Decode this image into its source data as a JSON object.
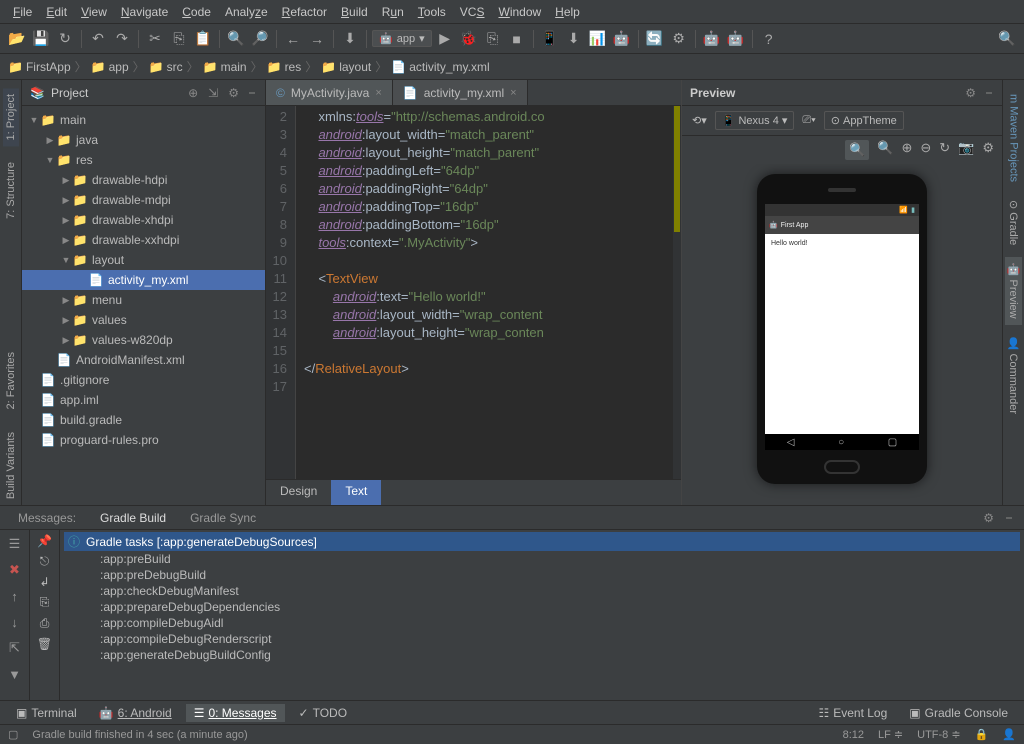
{
  "menu": {
    "items": [
      "File",
      "Edit",
      "View",
      "Navigate",
      "Code",
      "Analyze",
      "Refactor",
      "Build",
      "Run",
      "Tools",
      "VCS",
      "Window",
      "Help"
    ]
  },
  "toolbar": {
    "appSelector": "app"
  },
  "breadcrumb": [
    "FirstApp",
    "app",
    "src",
    "main",
    "res",
    "layout",
    "activity_my.xml"
  ],
  "leftGutter": {
    "project": "1: Project",
    "structure": "7: Structure",
    "favorites": "2: Favorites",
    "build": "Build Variants"
  },
  "rightGutter": {
    "maven": "Maven Projects",
    "gradle": "Gradle",
    "preview": "Preview",
    "commander": "Commander"
  },
  "projectPanel": {
    "title": "Project",
    "tree": [
      {
        "indent": 0,
        "arrow": "▼",
        "icon": "📁",
        "label": "main",
        "type": "folder"
      },
      {
        "indent": 1,
        "arrow": "▶",
        "icon": "📁",
        "label": "java",
        "type": "folder"
      },
      {
        "indent": 1,
        "arrow": "▼",
        "icon": "📁",
        "label": "res",
        "type": "folder"
      },
      {
        "indent": 2,
        "arrow": "▶",
        "icon": "📁",
        "label": "drawable-hdpi",
        "type": "folder"
      },
      {
        "indent": 2,
        "arrow": "▶",
        "icon": "📁",
        "label": "drawable-mdpi",
        "type": "folder"
      },
      {
        "indent": 2,
        "arrow": "▶",
        "icon": "📁",
        "label": "drawable-xhdpi",
        "type": "folder"
      },
      {
        "indent": 2,
        "arrow": "▶",
        "icon": "📁",
        "label": "drawable-xxhdpi",
        "type": "folder"
      },
      {
        "indent": 2,
        "arrow": "▼",
        "icon": "📁",
        "label": "layout",
        "type": "folder"
      },
      {
        "indent": 3,
        "arrow": "",
        "icon": "📄",
        "label": "activity_my.xml",
        "type": "xml",
        "selected": true
      },
      {
        "indent": 2,
        "arrow": "▶",
        "icon": "📁",
        "label": "menu",
        "type": "folder"
      },
      {
        "indent": 2,
        "arrow": "▶",
        "icon": "📁",
        "label": "values",
        "type": "folder"
      },
      {
        "indent": 2,
        "arrow": "▶",
        "icon": "📁",
        "label": "values-w820dp",
        "type": "folder"
      },
      {
        "indent": 1,
        "arrow": "",
        "icon": "📄",
        "label": "AndroidManifest.xml",
        "type": "xml"
      },
      {
        "indent": 0,
        "arrow": "",
        "icon": "📄",
        "label": ".gitignore",
        "type": "file"
      },
      {
        "indent": 0,
        "arrow": "",
        "icon": "📄",
        "label": "app.iml",
        "type": "iml"
      },
      {
        "indent": 0,
        "arrow": "",
        "icon": "📄",
        "label": "build.gradle",
        "type": "gradle"
      },
      {
        "indent": 0,
        "arrow": "",
        "icon": "📄",
        "label": "proguard-rules.pro",
        "type": "file"
      }
    ]
  },
  "editor": {
    "tabs": [
      {
        "icon": "©",
        "label": "MyActivity.java",
        "close": "×"
      },
      {
        "icon": "📄",
        "label": "activity_my.xml",
        "close": "×",
        "active": true
      }
    ],
    "linesStart": 2,
    "bottomTabs": {
      "design": "Design",
      "text": "Text"
    }
  },
  "preview": {
    "title": "Preview",
    "toolbar": {
      "device": "Nexus 4",
      "theme": "AppTheme"
    },
    "phone": {
      "appTitle": "First App",
      "content": "Hello world!"
    }
  },
  "messagesPanel": {
    "tabs": {
      "messages": "Messages:",
      "gradleBuild": "Gradle Build",
      "gradleSync": "Gradle Sync"
    },
    "header": "Gradle tasks [:app:generateDebugSources]",
    "lines": [
      ":app:preBuild",
      ":app:preDebugBuild",
      ":app:checkDebugManifest",
      ":app:prepareDebugDependencies",
      ":app:compileDebugAidl",
      ":app:compileDebugRenderscript",
      ":app:generateDebugBuildConfig"
    ]
  },
  "toolWindows": {
    "terminal": "Terminal",
    "android": "6: Android",
    "messages": "0: Messages",
    "todo": "TODO",
    "eventLog": "Event Log",
    "gradleConsole": "Gradle Console"
  },
  "statusbar": {
    "msg": "Gradle build finished in 4 sec (a minute ago)",
    "pos": "8:12",
    "lineSep": "LF",
    "encoding": "UTF-8"
  }
}
